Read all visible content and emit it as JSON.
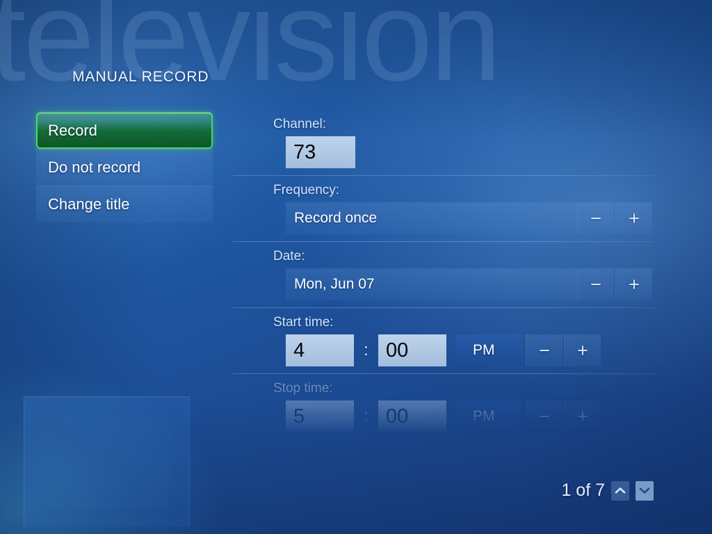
{
  "background": {
    "watermark_text": "television",
    "accent_green": "#4fd766",
    "base_blue": "#1f56a0"
  },
  "page_title": "MANUAL RECORD",
  "menu": {
    "items": [
      {
        "label": "Record",
        "selected": true
      },
      {
        "label": "Do not record",
        "selected": false
      },
      {
        "label": "Change title",
        "selected": false
      }
    ]
  },
  "form": {
    "channel": {
      "label": "Channel:",
      "value": "73"
    },
    "frequency": {
      "label": "Frequency:",
      "value": "Record once",
      "minus": "−",
      "plus": "+"
    },
    "date": {
      "label": "Date:",
      "value": "Mon, Jun 07",
      "minus": "−",
      "plus": "+"
    },
    "start_time": {
      "label": "Start time:",
      "hour": "4",
      "separator": ":",
      "minute": "00",
      "meridiem": "PM",
      "minus": "−",
      "plus": "+"
    },
    "stop_time": {
      "label": "Stop time:",
      "hour": "5",
      "separator": ":",
      "minute": "00",
      "meridiem": "PM",
      "minus": "−",
      "plus": "+"
    }
  },
  "pager": {
    "text": "1 of 7",
    "up_icon": "chevron-up-icon",
    "down_icon": "chevron-down-icon"
  }
}
